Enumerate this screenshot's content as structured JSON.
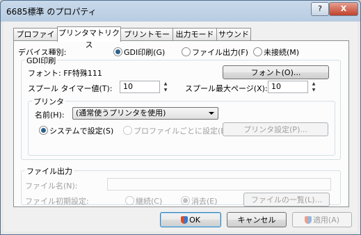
{
  "window": {
    "title": "6685標準 のプロパティ",
    "help_label": "?",
    "close_label": "X"
  },
  "tabs": [
    "プロファイル",
    "プリンタマトリクス",
    "プリントモード",
    "出力モード",
    "サウンド"
  ],
  "device_type": {
    "label": "デバイス種別:",
    "options": [
      "GDI印刷(G)",
      "ファイル出力(F)",
      "未接続(M)"
    ],
    "selected": "GDI印刷(G)"
  },
  "gdi": {
    "group_label": "GDI印刷",
    "font_text": "フォント: FF特殊111",
    "font_button": "フォント(O)...",
    "spool_timer_label": "スプール タイマー値(T):",
    "spool_timer_value": "10",
    "spool_max_label": "スプール最大ページ(X):",
    "spool_max_value": "10"
  },
  "printer": {
    "group_label": "プリンタ",
    "name_label": "名前(H):",
    "name_value": "(通常使うプリンタを使用)",
    "system_setting": "システムで設定(S)",
    "profile_setting": "プロファイルごとに設定(B)",
    "printer_settings_button": "プリンタ設定(P)..."
  },
  "file_output": {
    "group_label": "ファイル出力",
    "file_name_label": "ファイル名(N):",
    "file_name_value": "",
    "initial_setting_label": "ファイル初期設定:",
    "continue_option": "継続(C)",
    "delete_option": "消去(E)",
    "file_list_button": "ファイルの一覧(L)..."
  },
  "footer": {
    "ok": "OK",
    "cancel": "キャンセル",
    "apply": "適用(A)"
  }
}
